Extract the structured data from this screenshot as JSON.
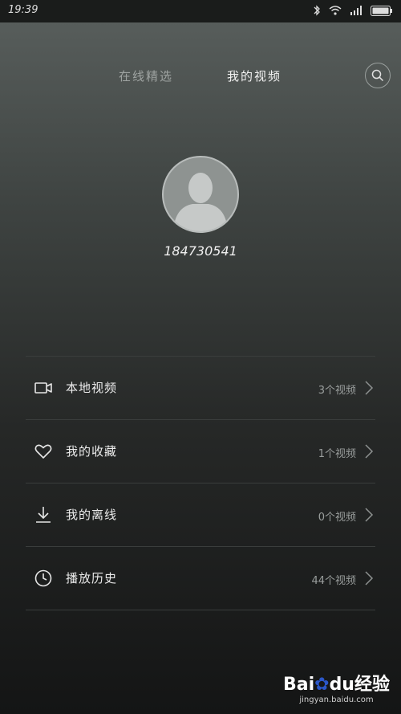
{
  "status_bar": {
    "time": "19:39"
  },
  "tabs": [
    {
      "label": "在线精选",
      "active": false
    },
    {
      "label": "我的视频",
      "active": true
    }
  ],
  "user": {
    "name": "184730541"
  },
  "menu": [
    {
      "icon": "video-camera-icon",
      "label": "本地视频",
      "count": "3个视频"
    },
    {
      "icon": "heart-icon",
      "label": "我的收藏",
      "count": "1个视频"
    },
    {
      "icon": "download-icon",
      "label": "我的离线",
      "count": "0个视频"
    },
    {
      "icon": "clock-icon",
      "label": "播放历史",
      "count": "44个视频"
    }
  ],
  "watermark": {
    "logo_a": "Bai",
    "logo_b": "du",
    "logo_c": "经验",
    "url": "jingyan.baidu.com"
  },
  "colors": {
    "background_top": "#5a605e",
    "background_bottom": "#141515",
    "active_tab": "#f2f2f2",
    "inactive_tab": "#9ea3a1"
  }
}
